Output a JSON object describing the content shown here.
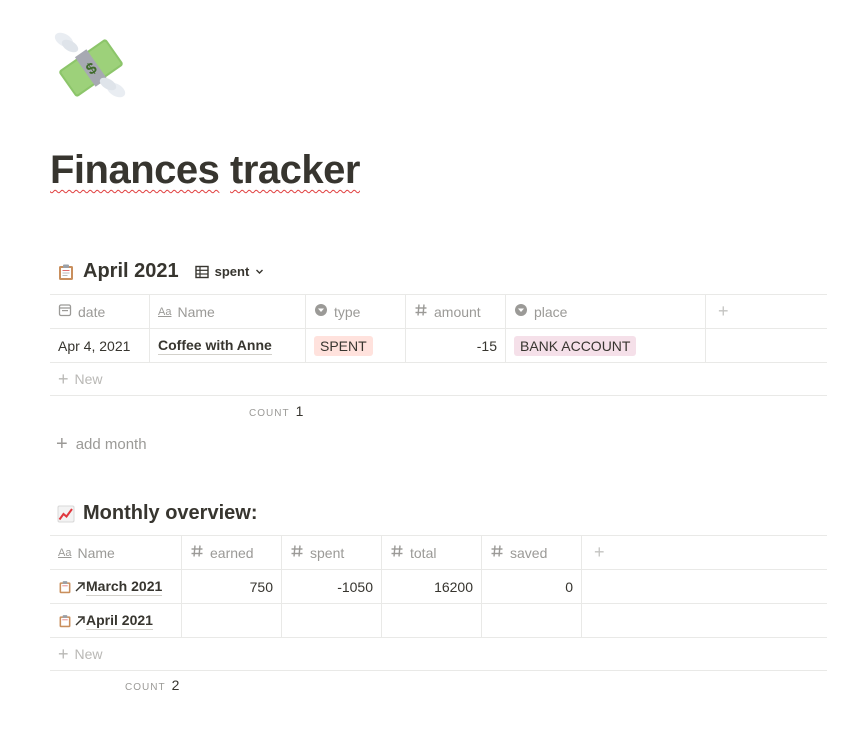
{
  "page": {
    "icon": "money-with-wings-icon",
    "title_word1": "Finances",
    "title_word2": "tracker"
  },
  "april_section": {
    "icon": "clipboard-icon",
    "title": "April 2021",
    "view_icon": "table-icon",
    "view_label": "spent",
    "columns": [
      {
        "label": "date",
        "icon": "calendar-icon"
      },
      {
        "label": "Name",
        "icon": "text-aa-icon"
      },
      {
        "label": "type",
        "icon": "select-icon"
      },
      {
        "label": "amount",
        "icon": "number-icon"
      },
      {
        "label": "place",
        "icon": "select-icon"
      }
    ],
    "rows": [
      {
        "date": "Apr 4, 2021",
        "name": "Coffee with Anne",
        "type": "SPENT",
        "amount": "-15",
        "place": "BANK ACCOUNT"
      }
    ],
    "new_label": "New",
    "count_label": "COUNT",
    "count_value": "1",
    "add_month_label": "add month",
    "colors": {
      "spent_tag": "#ffe2dd",
      "place_tag": "#f5e0e9"
    }
  },
  "overview_section": {
    "icon": "chart-increasing-icon",
    "title": "Monthly overview:",
    "columns": [
      {
        "label": "Name",
        "icon": "text-aa-icon"
      },
      {
        "label": "earned",
        "icon": "number-icon"
      },
      {
        "label": "spent",
        "icon": "number-icon"
      },
      {
        "label": "total",
        "icon": "number-icon"
      },
      {
        "label": "saved",
        "icon": "number-icon"
      }
    ],
    "rows": [
      {
        "name": "March 2021",
        "earned": "750",
        "spent": "-1050",
        "total": "16200",
        "saved": "0"
      },
      {
        "name": "April 2021",
        "earned": "",
        "spent": "",
        "total": "",
        "saved": ""
      }
    ],
    "new_label": "New",
    "count_label": "COUNT",
    "count_value": "2"
  }
}
